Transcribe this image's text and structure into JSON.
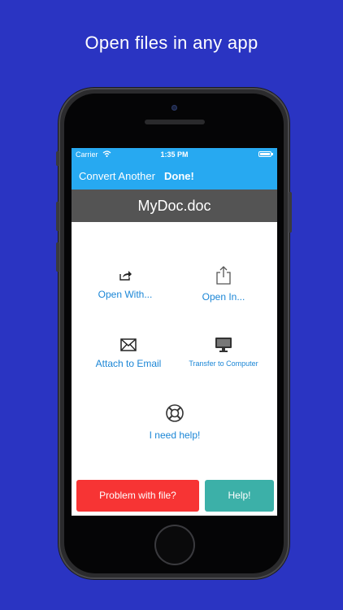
{
  "headline": "Open files in any app",
  "status": {
    "carrier": "Carrier",
    "time": "1:35 PM"
  },
  "nav": {
    "convert_label": "Convert Another",
    "done_label": "Done!"
  },
  "file": {
    "name": "MyDoc.doc"
  },
  "actions": {
    "open_with": "Open With...",
    "open_in": "Open In...",
    "attach_email": "Attach to Email",
    "transfer_computer": "Transfer to Computer",
    "need_help": "I need help!"
  },
  "buttons": {
    "problem": "Problem with file?",
    "help": "Help!"
  },
  "colors": {
    "background": "#2a34c2",
    "accent": "#27a9f1",
    "link": "#1b86d6",
    "danger": "#f73434",
    "teal": "#3cb0a8"
  }
}
